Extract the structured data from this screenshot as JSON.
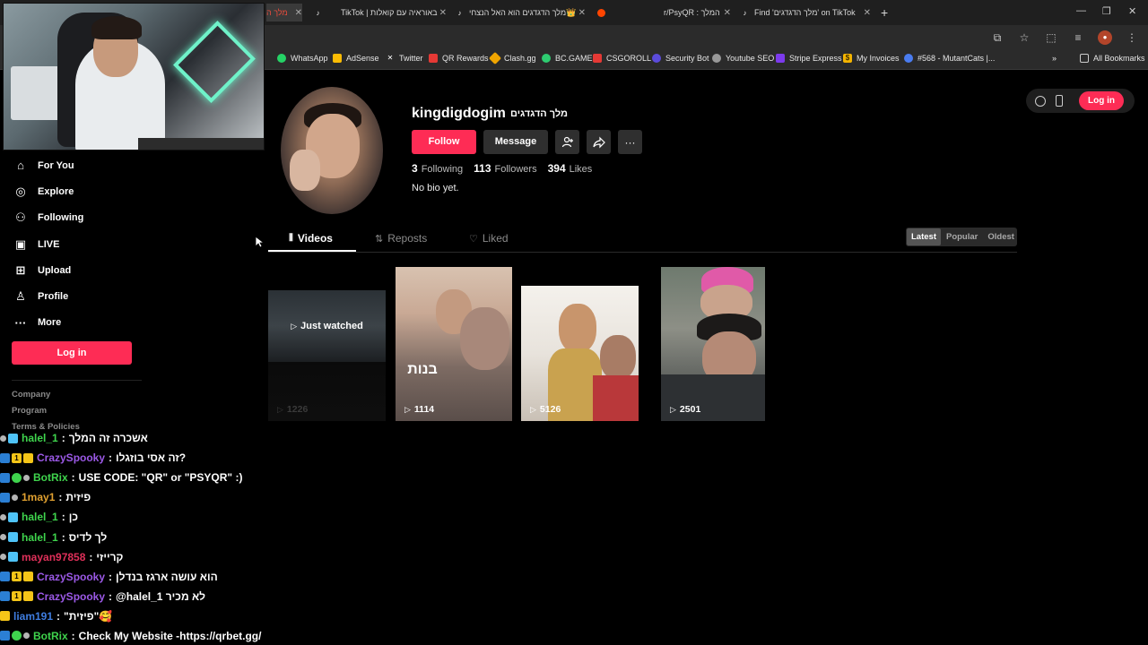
{
  "browser": {
    "tabs": [
      {
        "label": "מלך ה",
        "icon": "tiktok"
      },
      {
        "label": "",
        "icon": "tiktok"
      },
      {
        "label": "TikTok | באוראיה עם קואלות",
        "icon": "tiktok"
      },
      {
        "label": "מלך הדגדגים הוא האל הנצחי👑",
        "icon": "tiktok"
      },
      {
        "label": "",
        "icon": "reddit"
      },
      {
        "label": "r/PsyQR : המלך",
        "icon": "reddit"
      },
      {
        "label": "Find 'מלך הדגדגים' on TikTok",
        "icon": "tiktok"
      }
    ],
    "new_tab": "+",
    "bookmarks": [
      {
        "label": "WhatsApp",
        "color": "#25d366"
      },
      {
        "label": "AdSense",
        "color": "#fbbc04"
      },
      {
        "label": "Twitter",
        "color": "#000000"
      },
      {
        "label": "QR Rewards",
        "color": "#e53935"
      },
      {
        "label": "Clash.gg",
        "color": "#f0a500"
      },
      {
        "label": "BC.GAME",
        "color": "#2ecc71"
      },
      {
        "label": "CSGOROLL",
        "color": "#e53935"
      },
      {
        "label": "Security Bot",
        "color": "#5b4bdb"
      },
      {
        "label": "Youtube SEO",
        "color": "#999999"
      },
      {
        "label": "Stripe Express",
        "color": "#7c3aed"
      },
      {
        "label": "My Invoices",
        "color": "#f4b400"
      },
      {
        "label": "#568 - MutantCats |...",
        "color": "#4a7cf0"
      }
    ],
    "all_bookmarks": "All Bookmarks",
    "more_bookmarks": "»"
  },
  "sidebar": {
    "items": [
      {
        "label": "For You",
        "icon": "home-icon"
      },
      {
        "label": "Explore",
        "icon": "compass-icon"
      },
      {
        "label": "Following",
        "icon": "following-icon"
      },
      {
        "label": "LIVE",
        "icon": "live-icon"
      },
      {
        "label": "Upload",
        "icon": "upload-icon"
      },
      {
        "label": "Profile",
        "icon": "profile-icon"
      },
      {
        "label": "More",
        "icon": "more-icon"
      }
    ],
    "login_label": "Log in",
    "footer": [
      "Company",
      "Program",
      "Terms & Policies"
    ]
  },
  "profile": {
    "username": "kingdigdogim",
    "nickname": "מלך הדגדגים",
    "follow_label": "Follow",
    "message_label": "Message",
    "following_count": "3",
    "following_label": "Following",
    "followers_count": "113",
    "followers_label": "Followers",
    "likes_count": "394",
    "likes_label": "Likes",
    "bio": "No bio yet."
  },
  "tabs": {
    "videos": "Videos",
    "reposts": "Reposts",
    "liked": "Liked"
  },
  "sort": {
    "latest": "Latest",
    "popular": "Popular",
    "oldest": "Oldest"
  },
  "top_right": {
    "login_label": "Log in"
  },
  "videos": [
    {
      "views": "1226",
      "overlay": "Just watched"
    },
    {
      "views": "1114",
      "overlay": ""
    },
    {
      "views": "5126",
      "overlay": ""
    },
    {
      "views": "2501",
      "overlay": ""
    }
  ],
  "chat": [
    {
      "user": "halel_1",
      "color": "#3fd44d",
      "msg": "אשכרה זה המלך"
    },
    {
      "user": "CrazySpooky",
      "color": "#9b59e6",
      "msg": "זה אסי בוזגלו?"
    },
    {
      "user": "BotRix",
      "color": "#3fd44d",
      "msg": "USE CODE: \"QR\" or \"PSYQR\" :)"
    },
    {
      "user": "1may1",
      "color": "#e0a030",
      "msg": "פיזית"
    },
    {
      "user": "halel_1",
      "color": "#3fd44d",
      "msg": "כן"
    },
    {
      "user": "halel_1",
      "color": "#3fd44d",
      "msg": "לך לדיס"
    },
    {
      "user": "mayan97858",
      "color": "#e0305a",
      "msg": "קרייזי"
    },
    {
      "user": "CrazySpooky",
      "color": "#9b59e6",
      "msg": "הוא עושה ארגז בנדלן"
    },
    {
      "user": "CrazySpooky",
      "color": "#9b59e6",
      "msg": "@halel_1 לא מכיר"
    },
    {
      "user": "liam191",
      "color": "#3f7de0",
      "msg": "\"פיזית\"🥰"
    },
    {
      "user": "BotRix",
      "color": "#3fd44d",
      "msg": "Check My Website -https://qrbet.gg/"
    }
  ]
}
